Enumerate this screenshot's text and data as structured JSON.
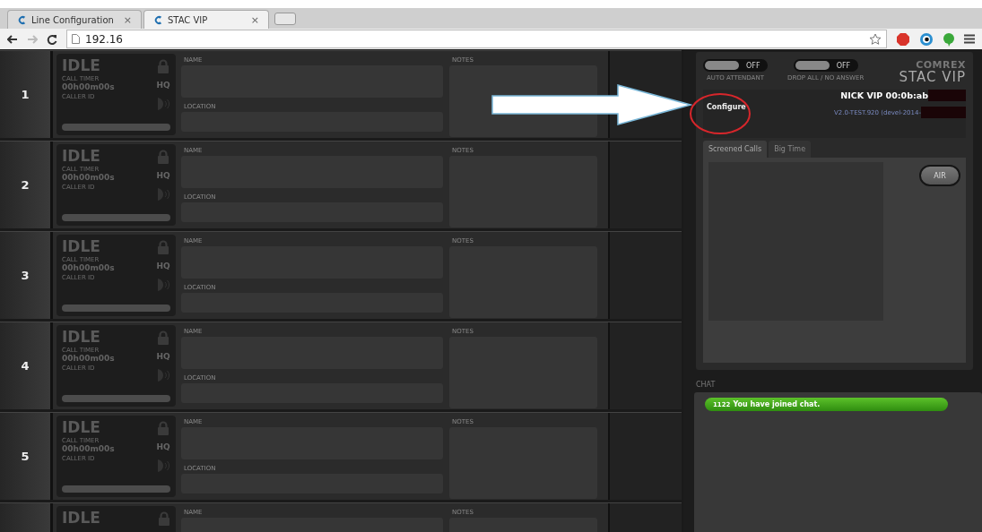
{
  "browser": {
    "tabs": [
      {
        "title": "Line Configuration",
        "selected": false,
        "close": "×"
      },
      {
        "title": "STAC VIP",
        "selected": true,
        "close": "×"
      }
    ],
    "address": "192.16"
  },
  "lines": [
    {
      "number": "1",
      "status": "IDLE",
      "timer_label": "CALL TIMER",
      "timer": "00h00m00s",
      "caller_label": "CALLER ID",
      "quality": "HQ",
      "name_label": "NAME",
      "location_label": "LOCATION",
      "notes_label": "NOTES"
    },
    {
      "number": "2",
      "status": "IDLE",
      "timer_label": "CALL TIMER",
      "timer": "00h00m00s",
      "caller_label": "CALLER ID",
      "quality": "HQ",
      "name_label": "NAME",
      "location_label": "LOCATION",
      "notes_label": "NOTES"
    },
    {
      "number": "3",
      "status": "IDLE",
      "timer_label": "CALL TIMER",
      "timer": "00h00m00s",
      "caller_label": "CALLER ID",
      "quality": "HQ",
      "name_label": "NAME",
      "location_label": "LOCATION",
      "notes_label": "NOTES"
    },
    {
      "number": "4",
      "status": "IDLE",
      "timer_label": "CALL TIMER",
      "timer": "00h00m00s",
      "caller_label": "CALLER ID",
      "quality": "HQ",
      "name_label": "NAME",
      "location_label": "LOCATION",
      "notes_label": "NOTES"
    },
    {
      "number": "5",
      "status": "IDLE",
      "timer_label": "CALL TIMER",
      "timer": "00h00m00s",
      "caller_label": "CALLER ID",
      "quality": "HQ",
      "name_label": "NAME",
      "location_label": "LOCATION",
      "notes_label": "NOTES"
    },
    {
      "status": "IDLE",
      "name_label": "NAME",
      "notes_label": "NOTES"
    }
  ],
  "control_panel": {
    "toggles": [
      {
        "state_text": "OFF",
        "on": false,
        "label": "AUTO ATTENDANT"
      },
      {
        "state_text": "OFF",
        "on": false,
        "label": "DROP ALL / NO ANSWER"
      }
    ],
    "logo_top": "COMREX",
    "logo_bottom": "STAC VIP",
    "configure": "Configure",
    "device_name": "NICK VIP 00:0b:ab",
    "version": "V2.0-TEST.920 (devel-2014-",
    "tabs": [
      {
        "label": "Screened Calls",
        "selected": true
      },
      {
        "label": "Big Time",
        "selected": false
      }
    ],
    "air_button": "AIR"
  },
  "chat": {
    "title": "CHAT",
    "messages": [
      {
        "time": "1122",
        "text": "You have joined chat."
      }
    ]
  }
}
